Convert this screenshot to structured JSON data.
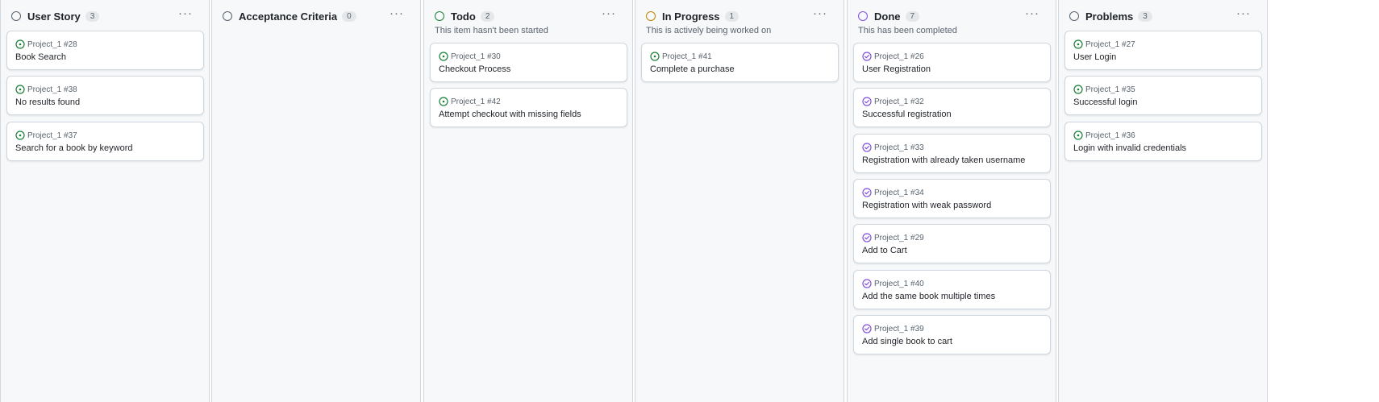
{
  "columns": [
    {
      "title": "User Story",
      "count": "3",
      "description": "",
      "status_color": "#59636e",
      "cards": [
        {
          "ref": "Project_1 #28",
          "title": "Book Search",
          "state": "open"
        },
        {
          "ref": "Project_1 #38",
          "title": "No results found",
          "state": "open"
        },
        {
          "ref": "Project_1 #37",
          "title": "Search for a book by keyword",
          "state": "open"
        }
      ]
    },
    {
      "title": "Acceptance Criteria",
      "count": "0",
      "description": "",
      "status_color": "#59636e",
      "cards": []
    },
    {
      "title": "Todo",
      "count": "2",
      "description": "This item hasn't been started",
      "status_color": "#1a7f37",
      "cards": [
        {
          "ref": "Project_1 #30",
          "title": "Checkout Process",
          "state": "open"
        },
        {
          "ref": "Project_1 #42",
          "title": "Attempt checkout with missing fields",
          "state": "open"
        }
      ]
    },
    {
      "title": "In Progress",
      "count": "1",
      "description": "This is actively being worked on",
      "status_color": "#bf8700",
      "cards": [
        {
          "ref": "Project_1 #41",
          "title": "Complete a purchase",
          "state": "open"
        }
      ]
    },
    {
      "title": "Done",
      "count": "7",
      "description": "This has been completed",
      "status_color": "#8250df",
      "cards": [
        {
          "ref": "Project_1 #26",
          "title": "User Registration",
          "state": "closed"
        },
        {
          "ref": "Project_1 #32",
          "title": "Successful registration",
          "state": "closed"
        },
        {
          "ref": "Project_1 #33",
          "title": "Registration with already taken username",
          "state": "closed"
        },
        {
          "ref": "Project_1 #34",
          "title": "Registration with weak password",
          "state": "closed"
        },
        {
          "ref": "Project_1 #29",
          "title": "Add to Cart",
          "state": "closed"
        },
        {
          "ref": "Project_1 #40",
          "title": "Add the same book multiple times",
          "state": "closed"
        },
        {
          "ref": "Project_1 #39",
          "title": "Add single book to cart",
          "state": "closed"
        }
      ]
    },
    {
      "title": "Problems",
      "count": "3",
      "description": "",
      "status_color": "#59636e",
      "cards": [
        {
          "ref": "Project_1 #27",
          "title": "User Login",
          "state": "open"
        },
        {
          "ref": "Project_1 #35",
          "title": "Successful login",
          "state": "open"
        },
        {
          "ref": "Project_1 #36",
          "title": "Login with invalid credentials",
          "state": "open"
        }
      ]
    }
  ],
  "menu_label": "···",
  "colors": {
    "open": "#1a7f37",
    "closed": "#8250df"
  },
  "icons": {
    "open": "issue-opened-icon",
    "closed": "issue-closed-icon"
  }
}
